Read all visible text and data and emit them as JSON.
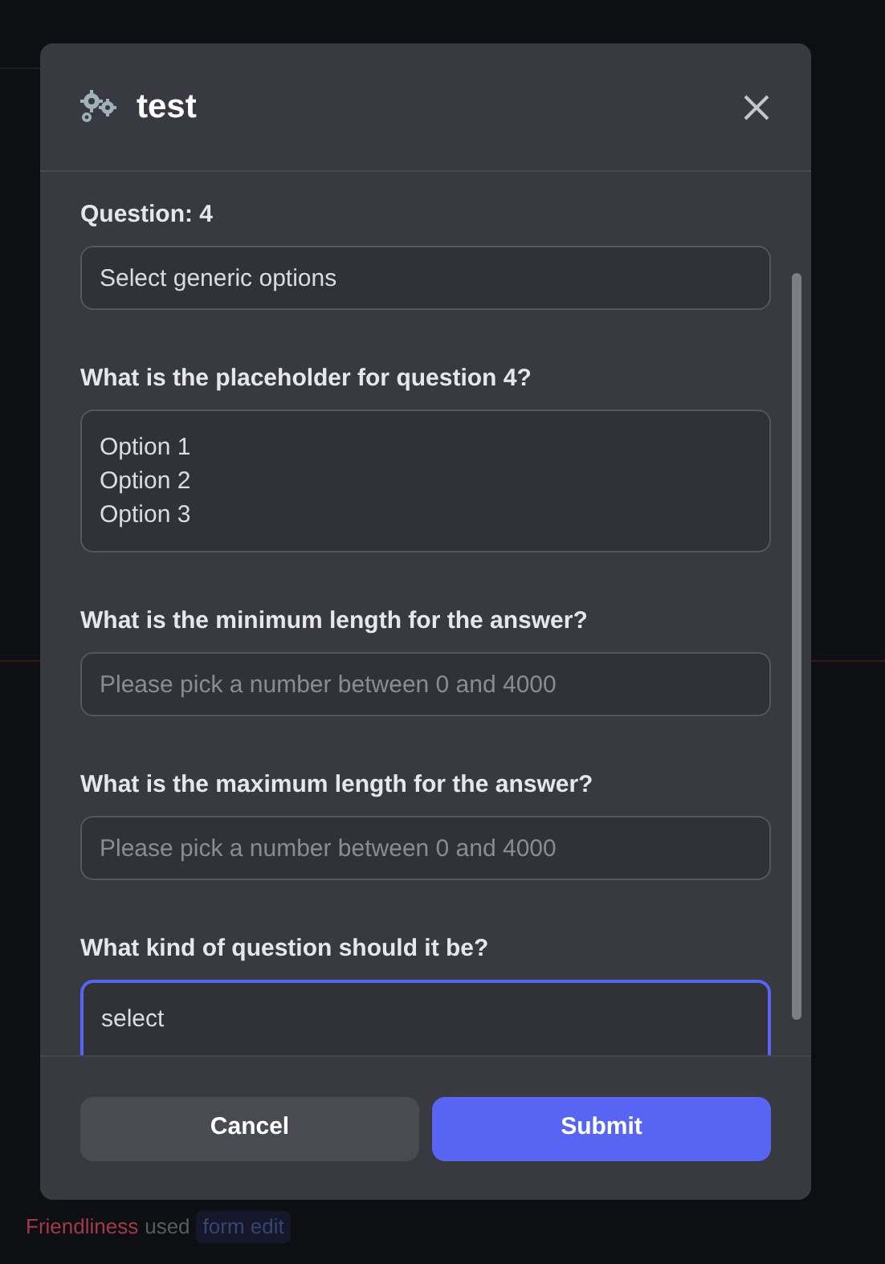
{
  "backdrop": {
    "user": "Friendliness",
    "action": "used",
    "command": "form edit"
  },
  "modal": {
    "title": "test",
    "fields": [
      {
        "kind": "input",
        "label": "Question: 4",
        "value": "Select generic options",
        "focused": false
      },
      {
        "kind": "textarea",
        "label": "What is the placeholder for question 4?",
        "value": "Option 1\nOption 2\nOption 3",
        "focused": false
      },
      {
        "kind": "input",
        "label": "What is the minimum length for the answer?",
        "placeholder": "Please pick a number between 0 and 4000",
        "focused": false
      },
      {
        "kind": "input",
        "label": "What is the maximum length for the answer?",
        "placeholder": "Please pick a number between 0 and 4000",
        "focused": false
      },
      {
        "kind": "textarea",
        "label": "What kind of question should it be?",
        "value": "select",
        "focused": true
      }
    ],
    "buttons": [
      {
        "kind": "secondary",
        "label": "Cancel"
      },
      {
        "kind": "primary",
        "label": "Submit"
      }
    ]
  }
}
